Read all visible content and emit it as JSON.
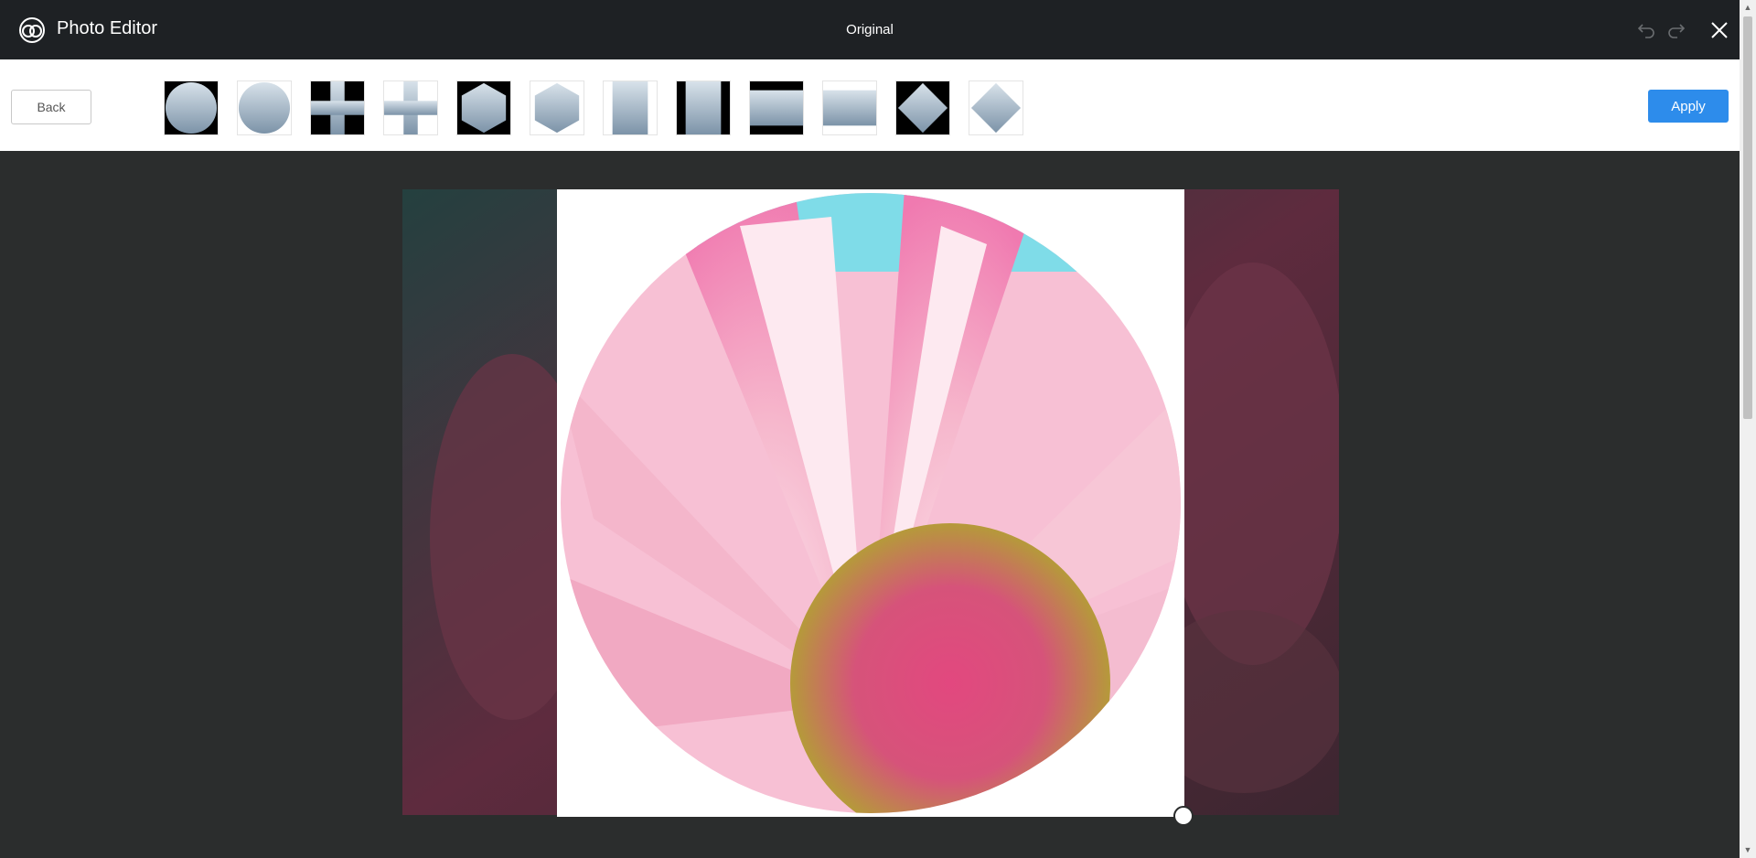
{
  "header": {
    "app_title": "Photo Editor",
    "mode_title": "Original",
    "undo_icon": "undo-icon",
    "redo_icon": "redo-icon",
    "close_icon": "close-icon"
  },
  "toolbar": {
    "back_label": "Back",
    "apply_label": "Apply",
    "shapes": [
      {
        "name": "circle-on-black"
      },
      {
        "name": "circle-on-white"
      },
      {
        "name": "cross-on-black"
      },
      {
        "name": "cross-on-white"
      },
      {
        "name": "hexagon-on-black"
      },
      {
        "name": "hexagon-on-white"
      },
      {
        "name": "portrait-on-white"
      },
      {
        "name": "portrait-on-black"
      },
      {
        "name": "landscape-on-black"
      },
      {
        "name": "landscape-on-white"
      },
      {
        "name": "diamond-on-black"
      },
      {
        "name": "diamond-on-white"
      }
    ]
  },
  "colors": {
    "titlebar": "#1e2124",
    "accent": "#2d8ceb",
    "canvas": "#2b2d2d"
  }
}
